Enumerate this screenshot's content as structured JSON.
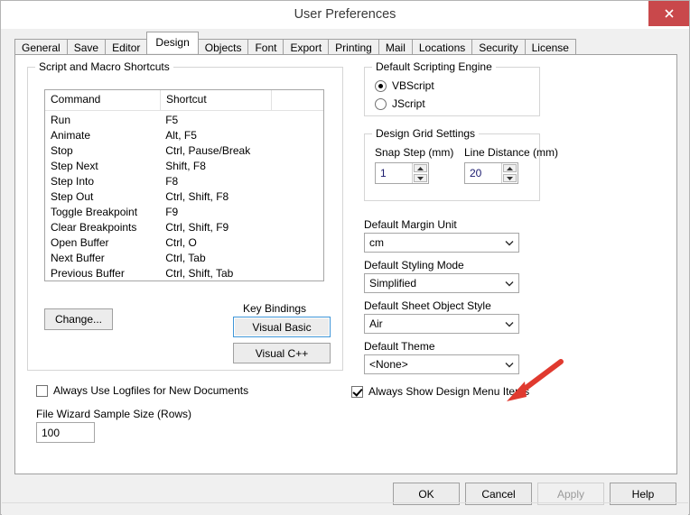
{
  "window": {
    "title": "User Preferences",
    "close_label": "✕",
    "accent_close_color": "#c9484b"
  },
  "tabs": [
    {
      "label": "General",
      "active": false
    },
    {
      "label": "Save",
      "active": false
    },
    {
      "label": "Editor",
      "active": false
    },
    {
      "label": "Design",
      "active": true
    },
    {
      "label": "Objects",
      "active": false
    },
    {
      "label": "Font",
      "active": false
    },
    {
      "label": "Export",
      "active": false
    },
    {
      "label": "Printing",
      "active": false
    },
    {
      "label": "Mail",
      "active": false
    },
    {
      "label": "Locations",
      "active": false
    },
    {
      "label": "Security",
      "active": false
    },
    {
      "label": "License",
      "active": false
    }
  ],
  "left_panel": {
    "group_title": "Script and Macro Shortcuts",
    "list": {
      "columns": [
        "Command",
        "Shortcut",
        ""
      ],
      "rows": [
        [
          "Run",
          "F5"
        ],
        [
          "Animate",
          "Alt, F5"
        ],
        [
          "Stop",
          "Ctrl, Pause/Break"
        ],
        [
          "Step Next",
          "Shift, F8"
        ],
        [
          "Step Into",
          "F8"
        ],
        [
          "Step Out",
          "Ctrl, Shift, F8"
        ],
        [
          "Toggle Breakpoint",
          "F9"
        ],
        [
          "Clear Breakpoints",
          "Ctrl, Shift, F9"
        ],
        [
          "Open Buffer",
          "Ctrl, O"
        ],
        [
          "Next Buffer",
          "Ctrl, Tab"
        ],
        [
          "Previous Buffer",
          "Ctrl, Shift, Tab"
        ]
      ]
    },
    "change_button": "Change...",
    "key_bindings_label": "Key Bindings",
    "visual_basic_button": "Visual Basic",
    "visual_cpp_button": "Visual C++"
  },
  "bottom_left": {
    "logfiles_checkbox_label": "Always Use Logfiles for New Documents",
    "logfiles_checked": false,
    "sample_size_label": "File Wizard Sample Size (Rows)",
    "sample_size_value": "100"
  },
  "right_panel": {
    "scripting_engine": {
      "group_title": "Default Scripting Engine",
      "options": [
        {
          "label": "VBScript",
          "selected": true
        },
        {
          "label": "JScript",
          "selected": false
        }
      ]
    },
    "grid_settings": {
      "group_title": "Design Grid Settings",
      "snap_step_label": "Snap Step (mm)",
      "snap_step_value": "1",
      "line_distance_label": "Line Distance (mm)",
      "line_distance_value": "20"
    },
    "margin_unit_label": "Default Margin Unit",
    "margin_unit_value": "cm",
    "styling_mode_label": "Default Styling Mode",
    "styling_mode_value": "Simplified",
    "sheet_object_style_label": "Default Sheet Object Style",
    "sheet_object_style_value": "Air",
    "theme_label": "Default Theme",
    "theme_value": "<None>",
    "design_menu_checkbox_label": "Always Show Design Menu Items",
    "design_menu_checked": true
  },
  "footer": {
    "buttons": [
      {
        "label": "OK",
        "disabled": false
      },
      {
        "label": "Cancel",
        "disabled": false
      },
      {
        "label": "Apply",
        "disabled": true
      },
      {
        "label": "Help",
        "disabled": false
      }
    ]
  },
  "annotation": {
    "arrow_color": "#e03a2f",
    "points_at": "design-menu-checkbox"
  }
}
